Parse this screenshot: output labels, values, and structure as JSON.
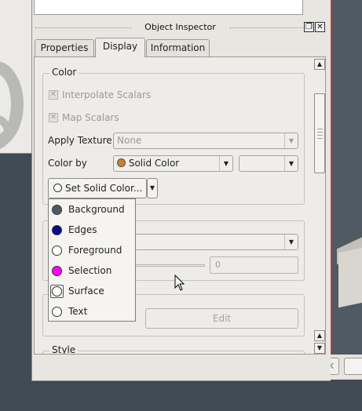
{
  "inspector": {
    "title": "Object Inspector",
    "tabs": [
      "Properties",
      "Display",
      "Information"
    ],
    "active_tab": "Display"
  },
  "color_group": {
    "title": "Color",
    "interpolate_scalars": {
      "label": "Interpolate Scalars",
      "checked": true,
      "enabled": false
    },
    "map_scalars": {
      "label": "Map Scalars",
      "checked": true,
      "enabled": false
    },
    "apply_texture": {
      "label": "Apply Texture",
      "value": "None"
    },
    "color_by": {
      "label": "Color by",
      "value": "Solid Color",
      "swatch": "#c87f3a"
    },
    "set_solid_color_label": "Set Solid Color..."
  },
  "color_menu": {
    "items": [
      {
        "label": "Background",
        "color": "#4d5a66"
      },
      {
        "label": "Edges",
        "color": "#0a0a8c"
      },
      {
        "label": "Foreground",
        "color": "#ffffff"
      },
      {
        "label": "Selection",
        "color": "#ff00ff"
      },
      {
        "label": "Surface",
        "color": "#ffffff"
      },
      {
        "label": "Text",
        "color": "#ffffff"
      }
    ]
  },
  "obscured_group": {
    "value_field": "0",
    "edit_label": "Edit"
  },
  "style_group": {
    "title": "Style"
  },
  "colors": {
    "accent_border": "#c83232",
    "desktop": "#3f4a53"
  }
}
